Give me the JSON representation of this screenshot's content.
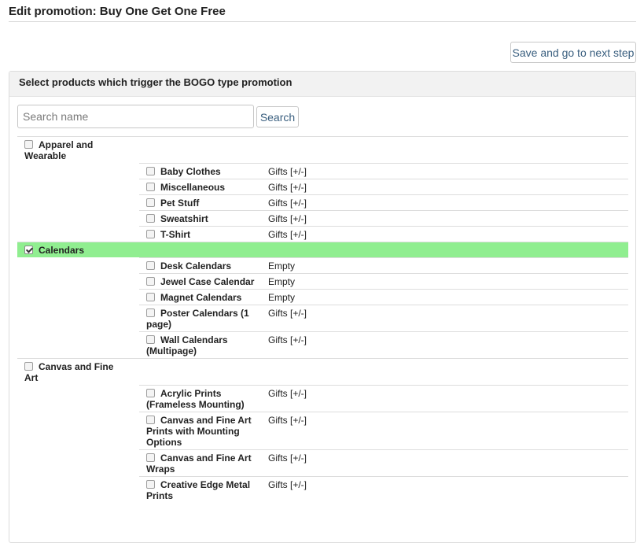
{
  "page": {
    "title": "Edit promotion: Buy One Get One Free",
    "save_label": "Save and go to next step"
  },
  "panel": {
    "header": "Select products which trigger the BOGO type promotion",
    "search_placeholder": "Search name",
    "search_value": "",
    "search_label": "Search"
  },
  "colors": {
    "selected_row": "#90ee90",
    "link_blue": "#3a5f7f"
  },
  "categories": [
    {
      "name": "Apparel and Wearable",
      "checked": false,
      "subcategories": [
        {
          "name": "Baby Clothes",
          "status": "Gifts [+/-]",
          "checked": false
        },
        {
          "name": "Miscellaneous",
          "status": "Gifts [+/-]",
          "checked": false
        },
        {
          "name": "Pet Stuff",
          "status": "Gifts [+/-]",
          "checked": false
        },
        {
          "name": "Sweatshirt",
          "status": "Gifts [+/-]",
          "checked": false
        },
        {
          "name": "T-Shirt",
          "status": "Gifts [+/-]",
          "checked": false
        }
      ]
    },
    {
      "name": "Calendars",
      "checked": true,
      "subcategories": [
        {
          "name": "Desk Calendars",
          "status": "Empty",
          "checked": false
        },
        {
          "name": "Jewel Case Calendar",
          "status": "Empty",
          "checked": false
        },
        {
          "name": "Magnet Calendars",
          "status": "Empty",
          "checked": false
        },
        {
          "name": "Poster Calendars (1 page)",
          "status": "Gifts [+/-]",
          "checked": false
        },
        {
          "name": "Wall Calendars (Multipage)",
          "status": "Gifts [+/-]",
          "checked": false
        }
      ]
    },
    {
      "name": "Canvas and Fine Art",
      "checked": false,
      "subcategories": [
        {
          "name": "Acrylic Prints (Frameless Mounting)",
          "status": "Gifts [+/-]",
          "checked": false
        },
        {
          "name": "Canvas and Fine Art Prints with Mounting Options",
          "status": "Gifts [+/-]",
          "checked": false
        },
        {
          "name": "Canvas and Fine Art Wraps",
          "status": "Gifts [+/-]",
          "checked": false
        },
        {
          "name": "Creative Edge Metal Prints",
          "status": "Gifts [+/-]",
          "checked": false
        }
      ]
    }
  ]
}
